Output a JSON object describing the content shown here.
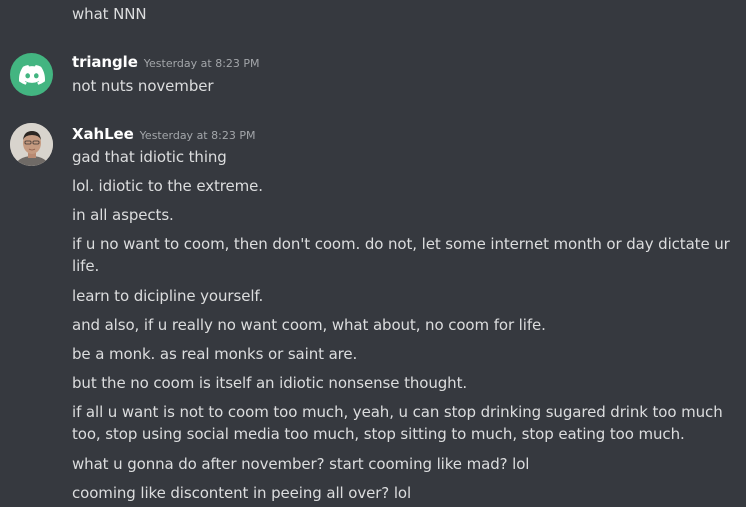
{
  "top_message": {
    "text": "what NNN"
  },
  "groups": [
    {
      "username": "triangle",
      "timestamp": "Yesterday at 8:23 PM",
      "avatar_icon": "discord-logo-icon",
      "avatar_color": "#43b581",
      "messages": [
        "not nuts november"
      ]
    },
    {
      "username": "XahLee",
      "timestamp": "Yesterday at 8:23 PM",
      "avatar_icon": "user-photo",
      "messages": [
        "gad that idiotic thing",
        "lol. idiotic to the extreme.",
        "in all aspects.",
        "if u no want to coom, then don't coom. do not, let some internet month or day dictate ur life.",
        "learn to dicipline yourself.",
        "and also, if u really no want coom, what about, no coom for life.",
        "be a monk. as real monks or saint are.",
        "but the no coom is itself an idiotic nonsense thought.",
        "if all u want is not to coom too much, yeah, u can stop drinking sugared drink too much too, stop using social media too much, stop sitting to much, stop eating too much.",
        "what u gonna do after november? start cooming like mad? lol",
        "cooming like discontent in peeing all over? lol"
      ]
    }
  ],
  "colors": {
    "background": "#36393f",
    "text": "#dcddde",
    "username": "#ffffff",
    "timestamp": "#a3a6aa"
  }
}
